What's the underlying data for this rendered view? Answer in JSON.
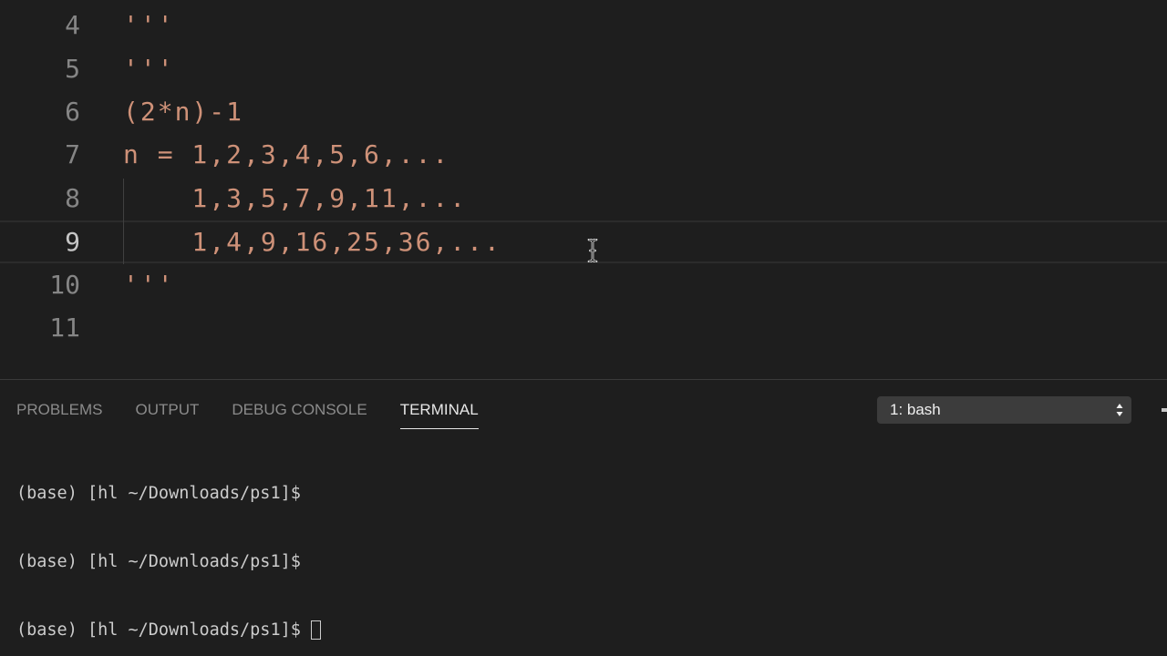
{
  "editor": {
    "lines": [
      {
        "number": "4",
        "code": "'''"
      },
      {
        "number": "5",
        "code": "'''"
      },
      {
        "number": "6",
        "code": "(2*n)-1"
      },
      {
        "number": "7",
        "code": "n = 1,2,3,4,5,6,..."
      },
      {
        "number": "8",
        "code": "    1,3,5,7,9,11,..."
      },
      {
        "number": "9",
        "code": "    1,4,9,16,25,36,..."
      },
      {
        "number": "10",
        "code": "'''"
      },
      {
        "number": "11",
        "code": ""
      }
    ],
    "current_line": "9"
  },
  "panel": {
    "tabs": [
      {
        "label": "PROBLEMS",
        "active": false
      },
      {
        "label": "OUTPUT",
        "active": false
      },
      {
        "label": "DEBUG CONSOLE",
        "active": false
      },
      {
        "label": "TERMINAL",
        "active": true
      }
    ],
    "terminal_select": {
      "value": "1: bash"
    },
    "terminal_lines": [
      "(base) [hl ~/Downloads/ps1]$",
      "(base) [hl ~/Downloads/ps1]$",
      "(base) [hl ~/Downloads/ps1]$"
    ]
  },
  "colors": {
    "background": "#1e1e1e",
    "string": "#ce9178",
    "line_number": "#858585",
    "line_number_active": "#c6c6c6",
    "terminal_text": "#cccccc",
    "select_bg": "#3c3c3c"
  },
  "icons": {
    "select_arrows": "updown-chevron-icon",
    "mouse_cursor": "ibeam-cursor-icon"
  }
}
